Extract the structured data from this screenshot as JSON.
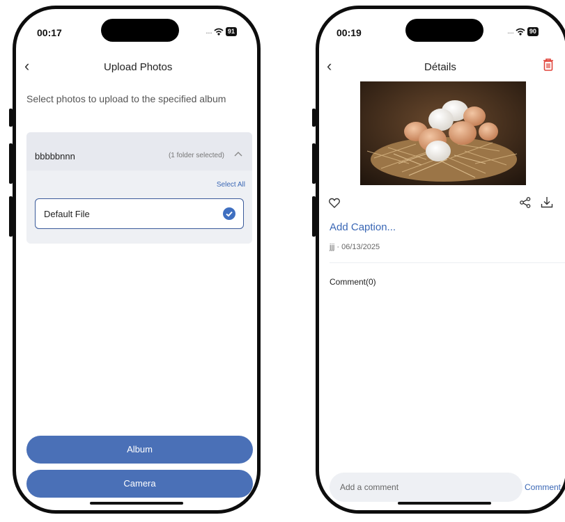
{
  "left_screen": {
    "status": {
      "time": "00:17",
      "battery": "91"
    },
    "nav": {
      "title": "Upload Photos"
    },
    "instruction": "Select photos to upload to the specified album",
    "folder": {
      "name": "bbbbbnnn",
      "selection_count": "(1 folder selected)",
      "select_all": "Select All",
      "file_label": "Default File"
    },
    "buttons": {
      "album": "Album",
      "camera": "Camera"
    }
  },
  "right_screen": {
    "status": {
      "time": "00:19",
      "battery": "90"
    },
    "nav": {
      "title": "Détails"
    },
    "caption_link": "Add Caption...",
    "meta": "jjj · 06/13/2025",
    "comment_count": "Comment(0)",
    "comment_placeholder": "Add a comment",
    "comment_button": "Comment"
  },
  "colors": {
    "accent": "#4a70b7",
    "link": "#3a67b5",
    "delete": "#e0443a",
    "card": "#eef0f4"
  },
  "icons": [
    "back-icon",
    "trash-icon",
    "heart-icon",
    "share-icon",
    "download-icon",
    "check-icon",
    "chevron-up-icon",
    "wifi-icon"
  ]
}
